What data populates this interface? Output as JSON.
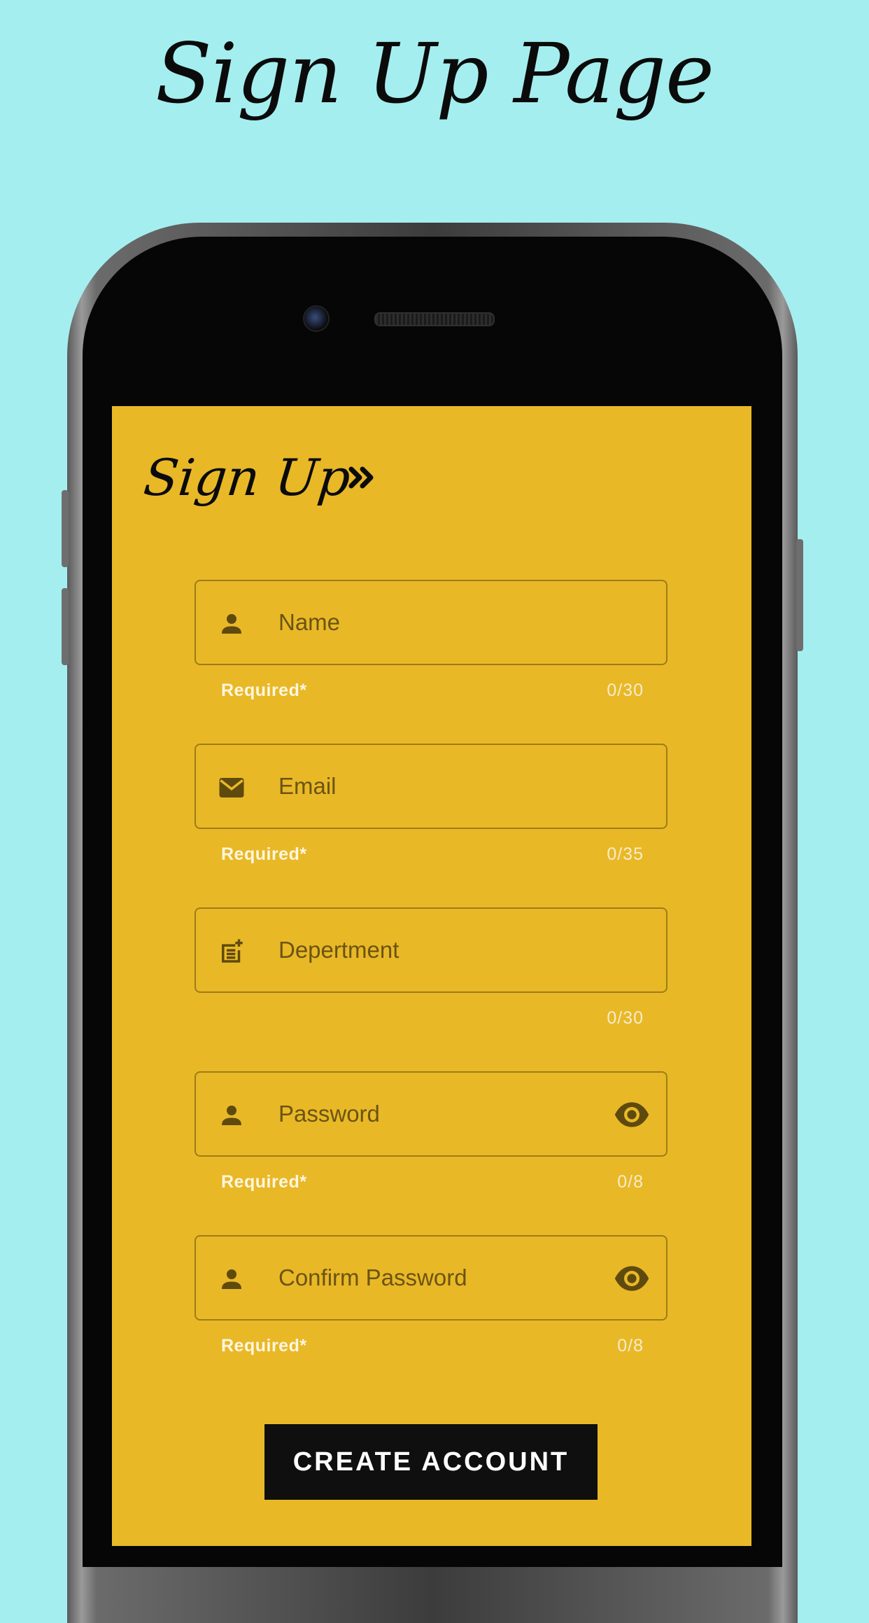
{
  "page": {
    "heading": "Sign Up Page"
  },
  "screen": {
    "title": "Sign Up",
    "background_color": "#e9b827",
    "chevron_icon": "double-chevron-right-icon",
    "fields": [
      {
        "id": "name",
        "placeholder": "Name",
        "icon": "person-icon",
        "helper": "Required*",
        "counter": "0/30",
        "toggle_visibility": false
      },
      {
        "id": "email",
        "placeholder": "Email",
        "icon": "mail-icon",
        "helper": "Required*",
        "counter": "0/35",
        "toggle_visibility": false
      },
      {
        "id": "department",
        "placeholder": "Depertment",
        "icon": "post-add-icon",
        "helper": "",
        "counter": "0/30",
        "toggle_visibility": false
      },
      {
        "id": "password",
        "placeholder": "Password",
        "icon": "person-icon",
        "helper": "Required*",
        "counter": "0/8",
        "toggle_visibility": true,
        "toggle_icon": "eye-icon"
      },
      {
        "id": "confirm_password",
        "placeholder": "Confirm Password",
        "icon": "person-icon",
        "helper": "Required*",
        "counter": "0/8",
        "toggle_visibility": true,
        "toggle_icon": "eye-icon"
      }
    ],
    "submit_label": "CREATE ACCOUNT"
  }
}
